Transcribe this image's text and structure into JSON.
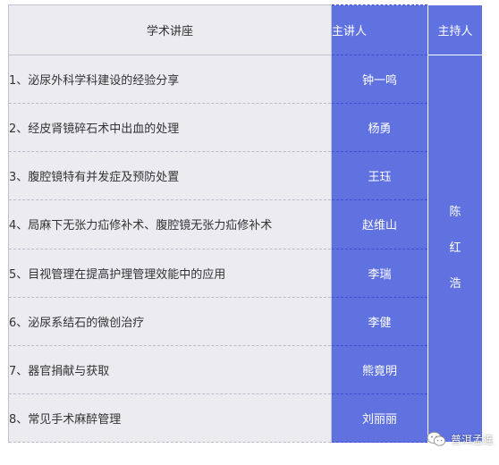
{
  "table": {
    "headers": {
      "lecture": "学术讲座",
      "speaker": "主讲人",
      "host": "主持人"
    },
    "rows": [
      {
        "lecture": "1、泌尿外科学科建设的经验分享",
        "speaker": "钟一鸣"
      },
      {
        "lecture": "2、经皮肾镜碎石术中出血的处理",
        "speaker": "杨勇"
      },
      {
        "lecture": "3、腹腔镜特有并发症及预防处置",
        "speaker": "王珏"
      },
      {
        "lecture": "4、局麻下无张力疝修补术、腹腔镜无张力疝修补术",
        "speaker": "赵维山"
      },
      {
        "lecture": "5、目视管理在提高护理管理效能中的应用",
        "speaker": "李瑞"
      },
      {
        "lecture": "6、泌尿系结石的微创治疗",
        "speaker": "李健"
      },
      {
        "lecture": "7、器官捐献与获取",
        "speaker": "熊竟明"
      },
      {
        "lecture": "8、常见手术麻醉管理",
        "speaker": "刘丽丽"
      }
    ],
    "host_name": [
      "陈",
      "红",
      "浩"
    ]
  },
  "watermark": {
    "text": "普洱孟连",
    "icon": "wechat-icon"
  },
  "colors": {
    "accent": "#6072e0",
    "row_bg": "#ebebf0"
  }
}
